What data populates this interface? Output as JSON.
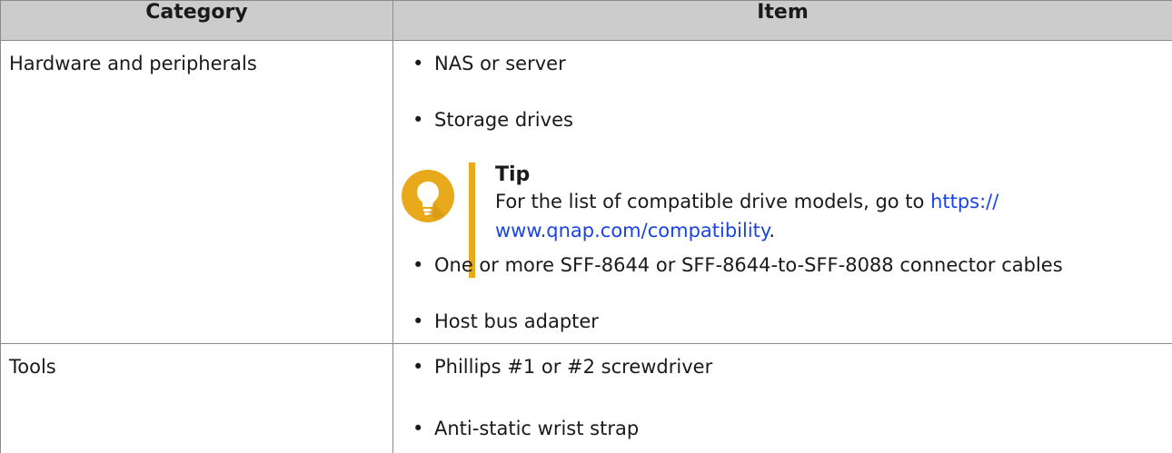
{
  "table": {
    "headers": {
      "category": "Category",
      "item": "Item"
    },
    "rows": [
      {
        "category": "Hardware and peripherals",
        "items": [
          "NAS or server",
          "Storage drives",
          "One or more SFF-8644 or SFF-8644-to-SFF-8088 connector cables",
          "Host bus adapter"
        ],
        "tip": {
          "title": "Tip",
          "text_before": "For the list of compatible drive models, go to ",
          "link_line1": "https://",
          "link_line2": "www.qnap.com/compatibility",
          "text_after": "."
        }
      },
      {
        "category": "Tools",
        "items": [
          "Phillips #1 or #2 screwdriver",
          "Anti-static wrist strap"
        ]
      }
    ]
  },
  "bullet_glyph": "•",
  "colors": {
    "header_bg": "#cccccc",
    "border": "#8a8a8a",
    "tip_accent": "#e8a91b",
    "link": "#1a44e6"
  },
  "icons": {
    "tip": "lightbulb-icon"
  }
}
